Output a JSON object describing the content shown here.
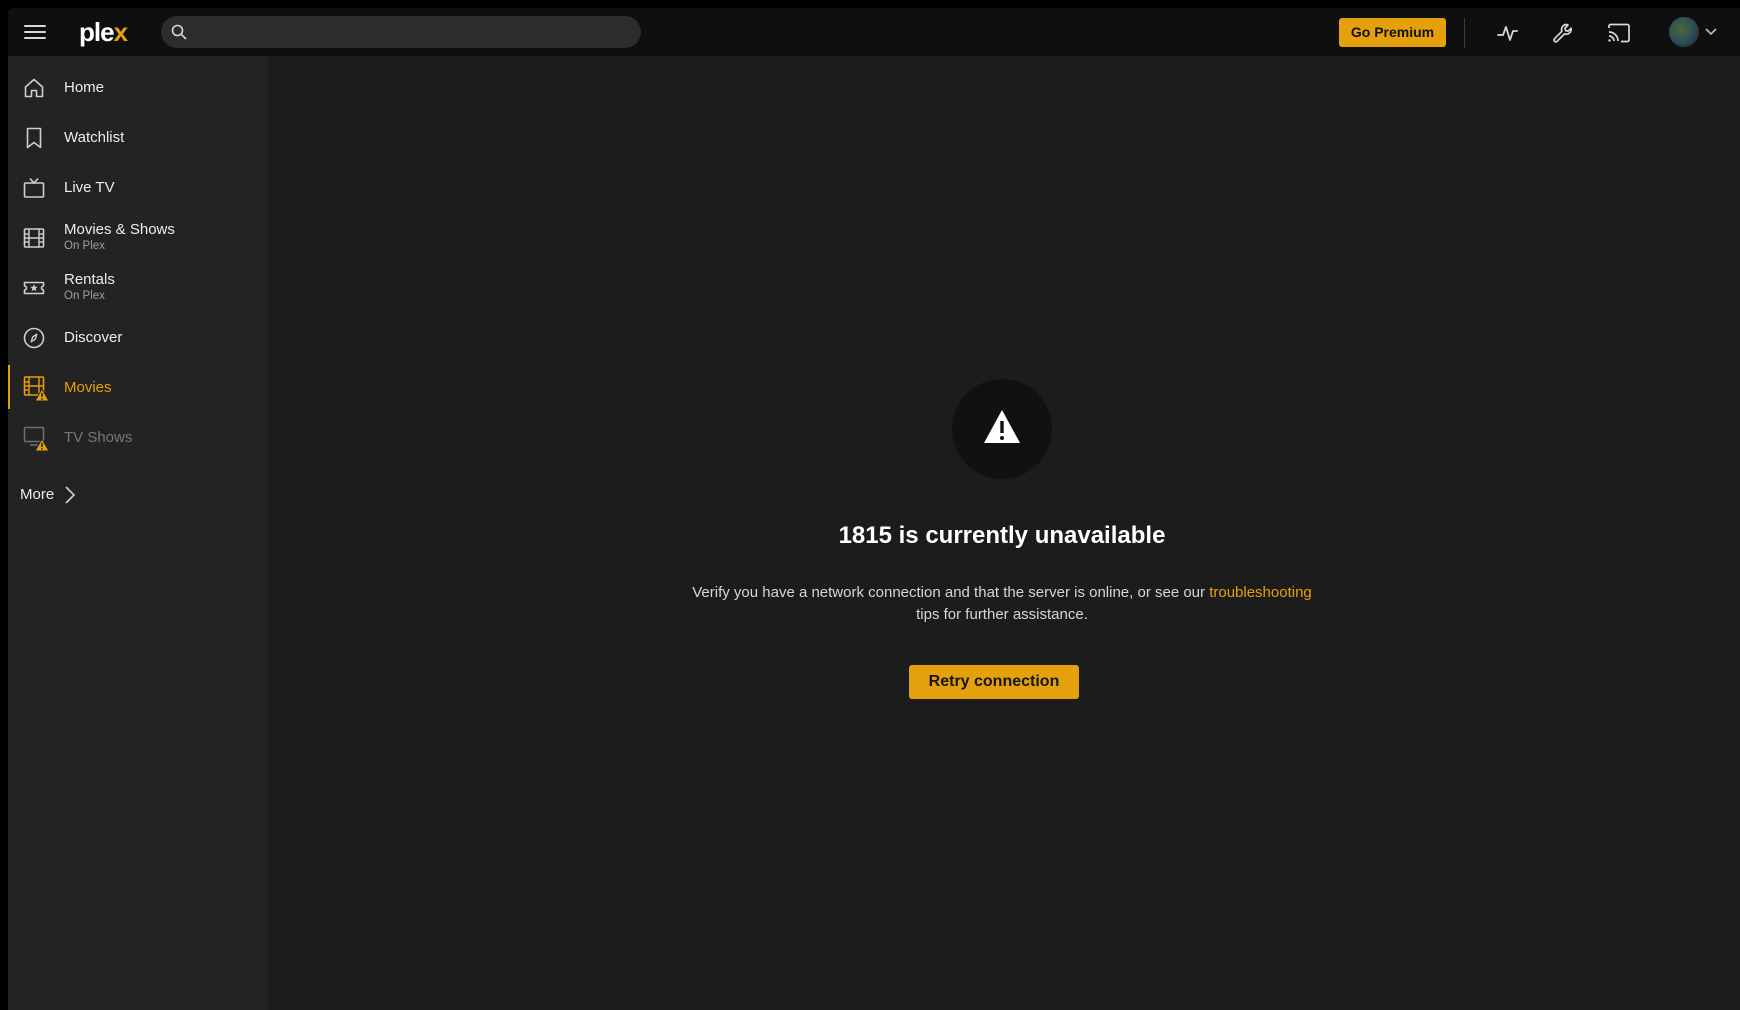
{
  "topbar": {
    "menu_icon": "hamburger-menu-icon",
    "logo": {
      "text": "ple",
      "accent": "x"
    },
    "search": {
      "placeholder": "",
      "value": ""
    },
    "premium_label": "Go Premium",
    "icons": [
      "activity-icon",
      "settings-wrench-icon",
      "cast-icon"
    ],
    "avatar_icon": "user-avatar",
    "chevron_icon": "chevron-down-icon"
  },
  "sidebar": {
    "items": [
      {
        "label": "Home",
        "sub": "",
        "icon": "home-icon"
      },
      {
        "label": "Watchlist",
        "sub": "",
        "icon": "bookmark-icon"
      },
      {
        "label": "Live TV",
        "sub": "",
        "icon": "tv-icon"
      },
      {
        "label": "Movies & Shows",
        "sub": "On Plex",
        "icon": "film-icon"
      },
      {
        "label": "Rentals",
        "sub": "On Plex",
        "icon": "ticket-star-icon"
      },
      {
        "label": "Discover",
        "sub": "",
        "icon": "compass-icon"
      },
      {
        "label": "Movies",
        "sub": "",
        "icon": "film-warning-icon",
        "active": true
      },
      {
        "label": "TV Shows",
        "sub": "",
        "icon": "monitor-warning-icon",
        "dimmed": true
      }
    ],
    "more_label": "More"
  },
  "main": {
    "icon": "warning-triangle-icon",
    "title": "1815 is currently unavailable",
    "text_before": "Verify you have a network connection and that the server is online, or see our ",
    "link": "troubleshooting",
    "text_after": " tips for further assistance.",
    "retry_label": "Retry connection"
  },
  "colors": {
    "accent": "#e5a00d",
    "background": "#1c1c1c",
    "topbar": "#0f0f0f",
    "sidebar": "#232323"
  }
}
